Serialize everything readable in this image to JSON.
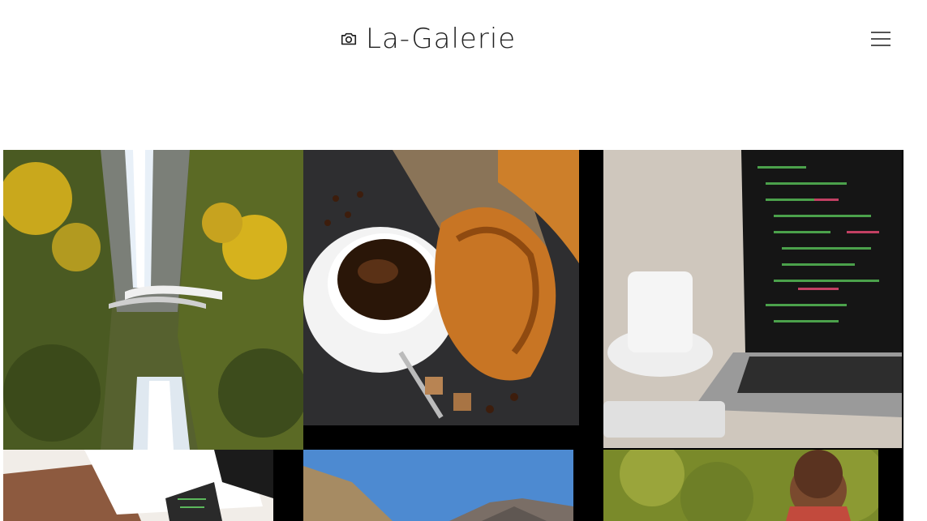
{
  "header": {
    "brand_title": "La-Galerie",
    "camera_icon": "camera-icon",
    "menu_icon": "hamburger-menu-icon"
  },
  "gallery": {
    "photos": [
      {
        "subject": "waterfall-bridge"
      },
      {
        "subject": "coffee-croissant"
      },
      {
        "subject": "laptop-code-coffee"
      },
      {
        "subject": "desk-laptop"
      },
      {
        "subject": "mountain-landscape"
      },
      {
        "subject": "smiling-child"
      }
    ]
  },
  "colors": {
    "brand_text": "#222222",
    "menu_lines": "#555555",
    "gallery_bg": "#000000"
  }
}
